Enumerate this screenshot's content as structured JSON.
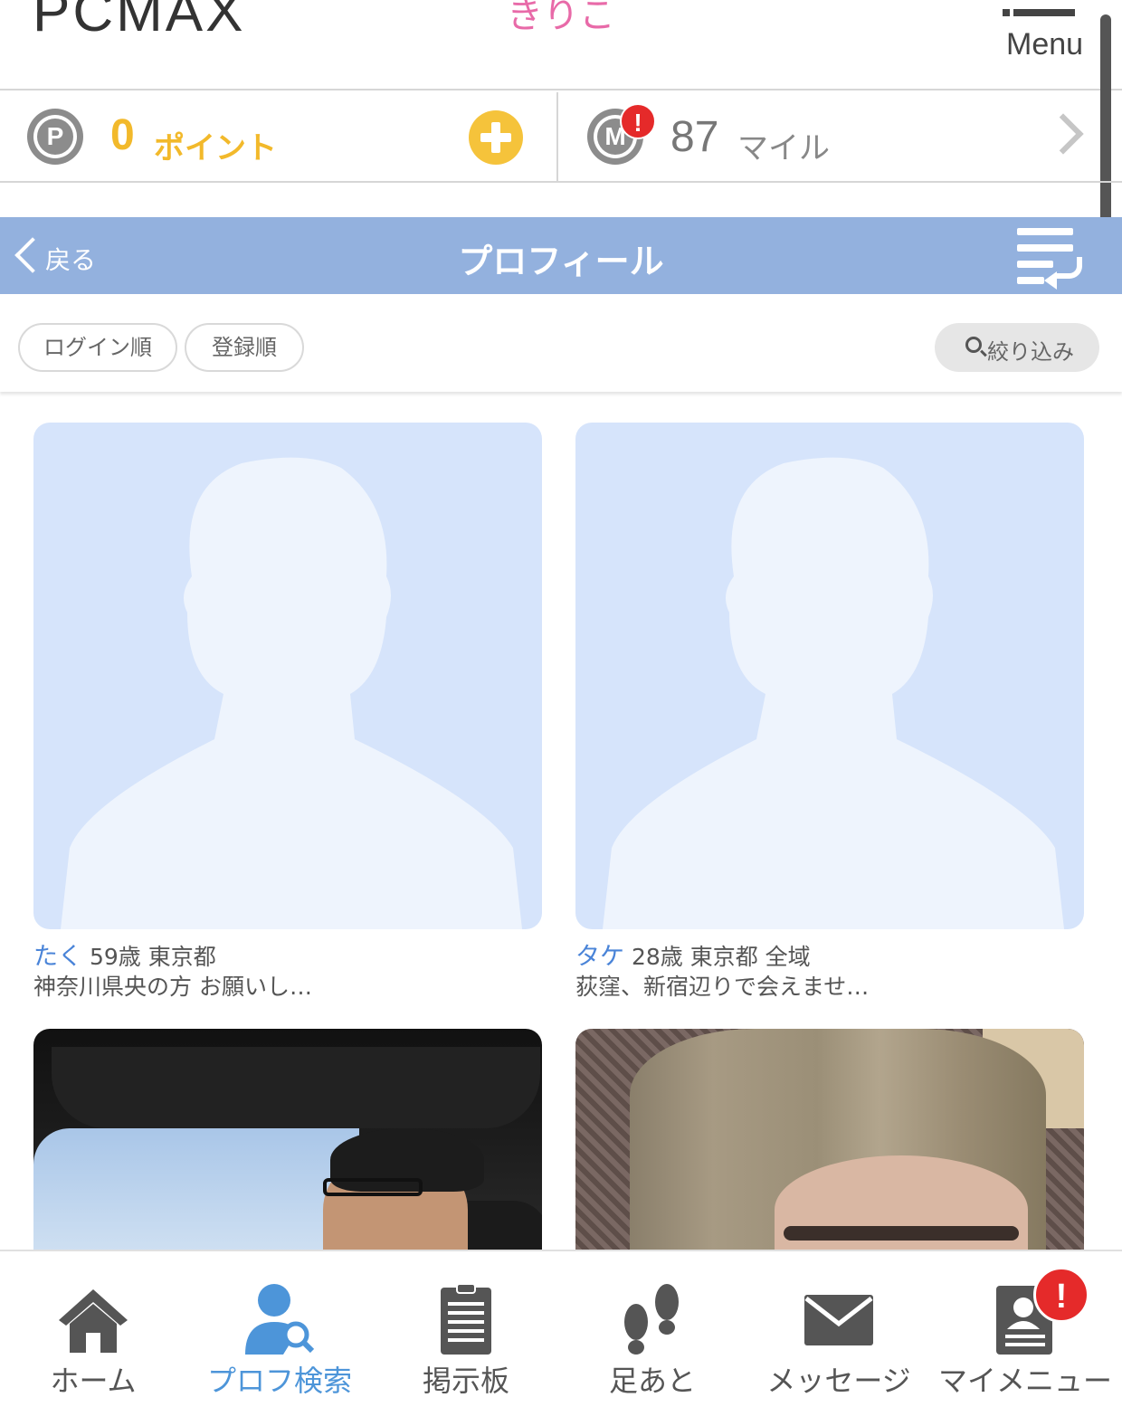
{
  "header": {
    "logo": "PCMAX",
    "username": "きりこ",
    "menu_label": "Menu"
  },
  "points": {
    "points_icon_letter": "P",
    "points_value": "0",
    "points_unit": "ポイント",
    "miles_icon_letter": "M",
    "miles_alert": "!",
    "miles_value": "87",
    "miles_unit": "マイル"
  },
  "titlebar": {
    "back_label": "戻る",
    "title": "プロフィール"
  },
  "sort": {
    "login_order": "ログイン順",
    "register_order": "登録順",
    "filter": "絞り込み"
  },
  "profiles": [
    {
      "name": "たく",
      "info": "59歳 東京都",
      "message": "神奈川県央の方 お願いし…"
    },
    {
      "name": "タケ",
      "info": "28歳 東京都 全域",
      "message": "荻窪、新宿辺りで会えませ…"
    },
    {
      "name": "",
      "info": "",
      "message": ""
    },
    {
      "name": "",
      "info": "",
      "message": ""
    }
  ],
  "nav": {
    "items": [
      {
        "label": "ホーム",
        "icon": "home-icon"
      },
      {
        "label": "プロフ検索",
        "icon": "profile-search-icon"
      },
      {
        "label": "掲示板",
        "icon": "bulletin-board-icon"
      },
      {
        "label": "足あと",
        "icon": "footprints-icon"
      },
      {
        "label": "メッセージ",
        "icon": "envelope-icon"
      },
      {
        "label": "マイメニュー",
        "icon": "my-menu-icon"
      }
    ],
    "mymenu_alert": "!"
  },
  "colors": {
    "accent_blue": "#93b1de",
    "points_yellow": "#f2b92b",
    "alert_red": "#e52a2a",
    "username_pink": "#e86aa8",
    "active_nav": "#4d95d9"
  }
}
